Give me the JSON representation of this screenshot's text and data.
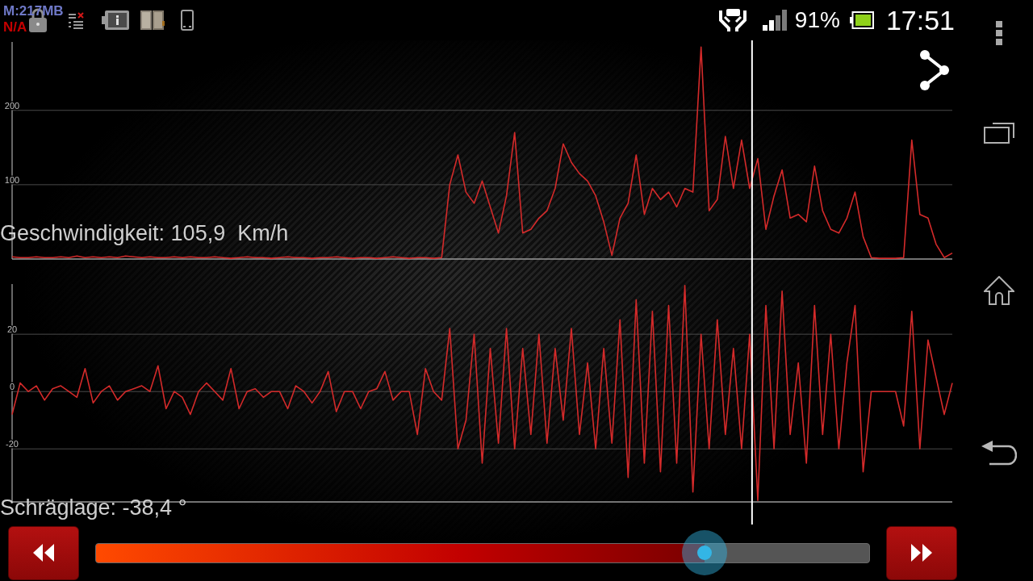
{
  "status_bar": {
    "memory": "M:217MB",
    "status": "N/A",
    "battery": "91%",
    "time": "17:51"
  },
  "charts": [
    {
      "reading": "Geschwindigkeit: 105,9  Km/h",
      "chart_data": {
        "type": "line",
        "ylim": [
          0,
          292
        ],
        "yticks": [
          100,
          200
        ],
        "grid": true,
        "series": [
          {
            "color": "#d42a2a",
            "values": [
              3,
              2,
              2,
              3,
              2,
              2,
              3,
              2,
              4,
              2,
              3,
              2,
              3,
              2,
              4,
              3,
              2,
              3,
              2,
              2,
              3,
              2,
              3,
              2,
              2,
              3,
              2,
              1,
              2,
              3,
              2,
              2,
              1,
              2,
              3,
              2,
              2,
              1,
              2,
              2,
              3,
              2,
              1,
              2,
              2,
              1,
              2,
              3,
              2,
              1,
              2,
              2,
              1,
              2,
              100,
              140,
              90,
              75,
              105,
              70,
              35,
              85,
              170,
              35,
              40,
              55,
              65,
              95,
              155,
              130,
              115,
              105,
              85,
              50,
              5,
              55,
              75,
              140,
              60,
              95,
              80,
              90,
              70,
              95,
              90,
              285,
              65,
              80,
              165,
              95,
              160,
              95,
              135,
              40,
              85,
              120,
              55,
              60,
              50,
              125,
              65,
              40,
              35,
              55,
              90,
              30,
              2,
              1,
              1,
              1,
              2,
              160,
              60,
              55,
              20,
              2,
              8
            ]
          }
        ]
      }
    },
    {
      "reading": "Schräglage: -38,4 °",
      "chart_data": {
        "type": "line",
        "ylim": [
          -38.5,
          37.5
        ],
        "yticks": [
          -20,
          0,
          20
        ],
        "grid": true,
        "series": [
          {
            "color": "#d42a2a",
            "values": [
              -8,
              3,
              0,
              2,
              -3,
              1,
              2,
              0,
              -2,
              8,
              -4,
              0,
              2,
              -3,
              0,
              1,
              2,
              0,
              9,
              -6,
              0,
              -2,
              -8,
              0,
              3,
              0,
              -3,
              8,
              -6,
              0,
              1,
              -2,
              0,
              0,
              -6,
              2,
              0,
              -4,
              0,
              7,
              -7,
              0,
              0,
              -6,
              0,
              1,
              7,
              -3,
              0,
              0,
              -15,
              8,
              0,
              -3,
              22,
              -20,
              -10,
              20,
              -25,
              15,
              -18,
              22,
              -20,
              15,
              -15,
              20,
              -18,
              15,
              -10,
              22,
              -15,
              10,
              -20,
              15,
              -18,
              25,
              -30,
              32,
              -25,
              28,
              -28,
              30,
              -25,
              37,
              -35,
              20,
              -20,
              25,
              -15,
              15,
              -20,
              20,
              -38,
              30,
              -20,
              35,
              -15,
              10,
              -25,
              30,
              -15,
              20,
              -20,
              10,
              30,
              -28,
              0,
              0,
              0,
              0,
              -12,
              28,
              -20,
              18,
              5,
              -8,
              3
            ]
          }
        ]
      }
    }
  ],
  "playback": {
    "level": 0.787
  }
}
